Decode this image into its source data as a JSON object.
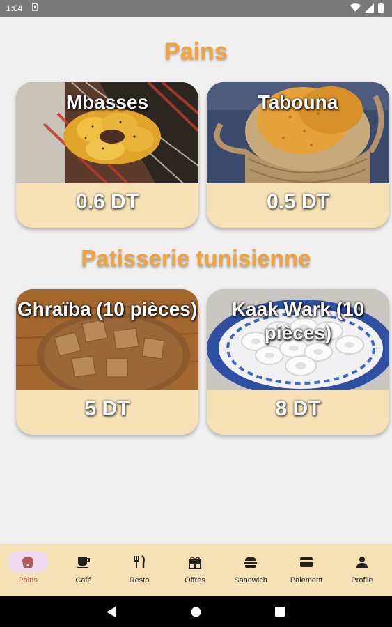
{
  "status": {
    "time": "1:04"
  },
  "sections": [
    {
      "title": "Pains",
      "items": [
        {
          "name": "Mbasses",
          "price": "0.6 DT"
        },
        {
          "name": "Tabouna",
          "price": "0.5 DT"
        }
      ]
    },
    {
      "title": "Patisserie tunisienne",
      "items": [
        {
          "name": "Ghraïba (10 pièces)",
          "price": "5 DT"
        },
        {
          "name": "Kaak Wark (10 pièces)",
          "price": "8 DT"
        }
      ]
    }
  ],
  "nav": {
    "active": "Pains",
    "items": [
      {
        "label": "Pains",
        "icon": "bread-icon"
      },
      {
        "label": "Café",
        "icon": "coffee-icon"
      },
      {
        "label": "Resto",
        "icon": "restaurant-icon"
      },
      {
        "label": "Offres",
        "icon": "gift-icon"
      },
      {
        "label": "Sandwich",
        "icon": "burger-icon"
      },
      {
        "label": "Paiement",
        "icon": "card-icon"
      },
      {
        "label": "Profile",
        "icon": "person-icon"
      }
    ]
  },
  "colors": {
    "section_title": "#f0a440",
    "card_bg": "#f6e1b6",
    "nav_bg": "#f6e1b6",
    "active_pill": "#ecd9ef",
    "active_label": "#b05a5a"
  }
}
